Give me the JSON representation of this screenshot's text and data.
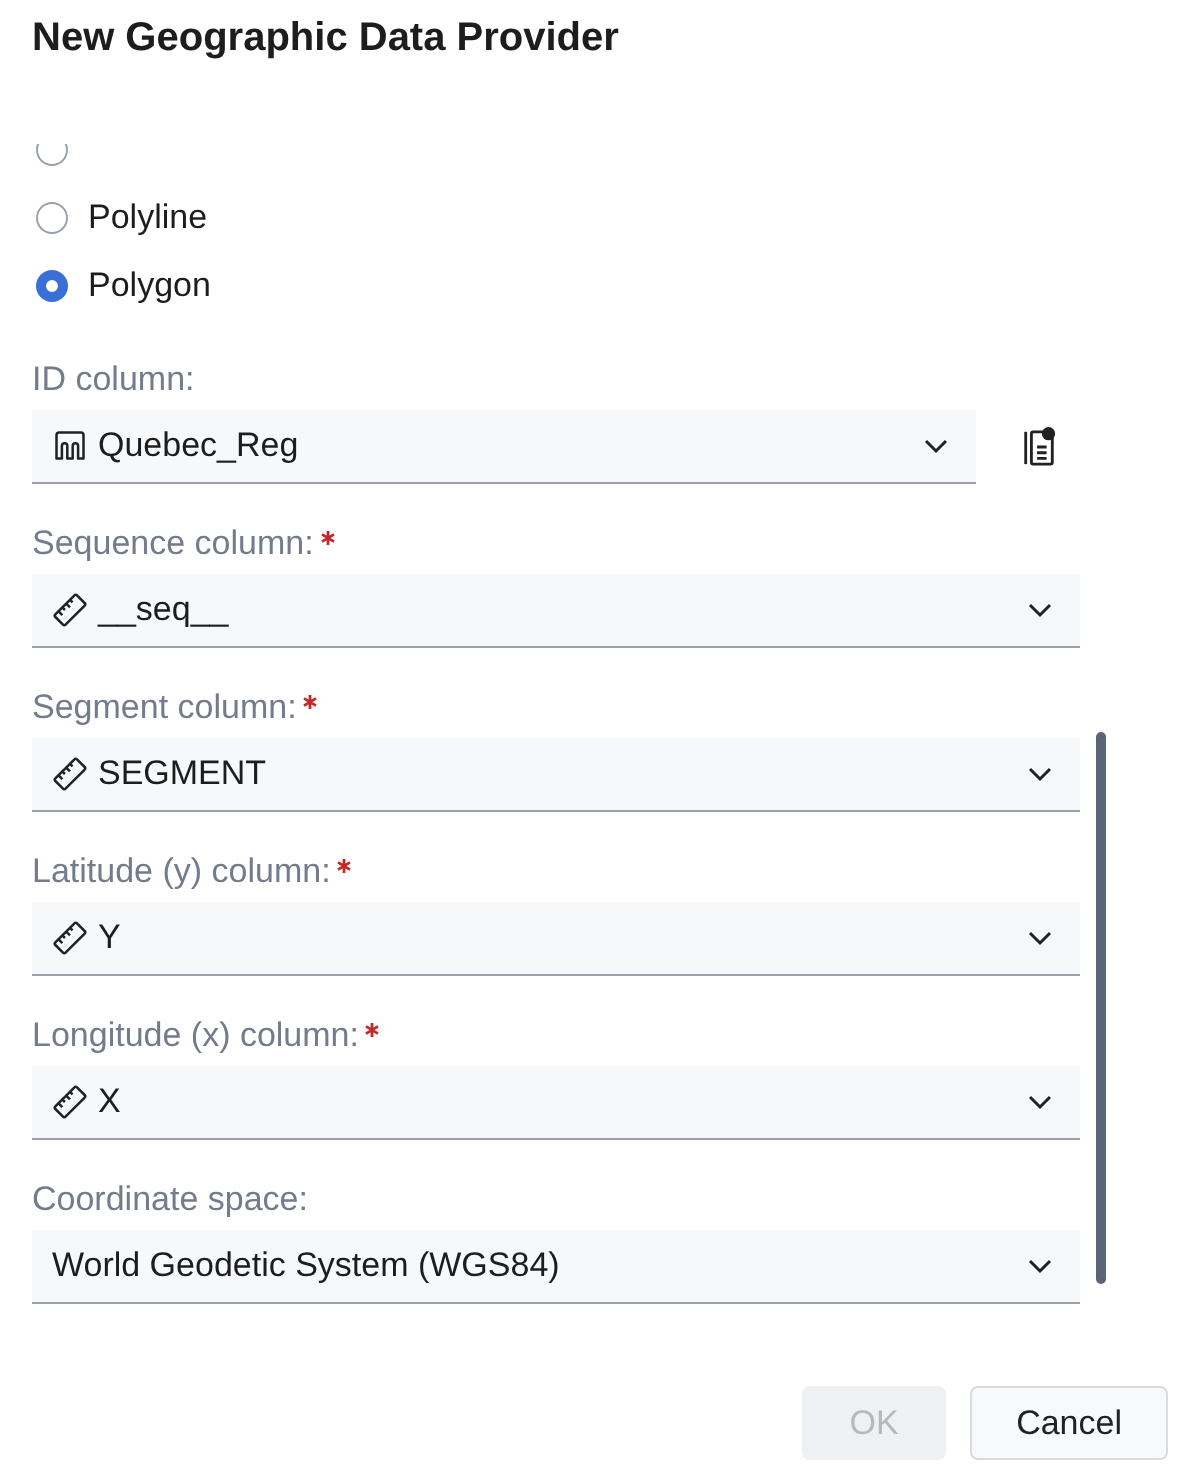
{
  "dialog": {
    "title": "New Geographic Data Provider"
  },
  "geometry_options": [
    {
      "selected": false
    },
    {
      "label": "Polyline",
      "selected": false
    },
    {
      "label": "Polygon",
      "selected": true
    }
  ],
  "fields": [
    {
      "label": "ID column:",
      "required": false,
      "kind": "shape",
      "value": "Quebec_Reg",
      "side_button": true
    },
    {
      "label": "Sequence column:",
      "required": true,
      "kind": "ruler",
      "value": "__seq__",
      "side_button": false
    },
    {
      "label": "Segment column:",
      "required": true,
      "kind": "ruler",
      "value": "SEGMENT",
      "side_button": false
    },
    {
      "label": "Latitude (y) column:",
      "required": true,
      "kind": "ruler",
      "value": "Y",
      "side_button": false
    },
    {
      "label": "Longitude (x) column:",
      "required": true,
      "kind": "ruler",
      "value": "X",
      "side_button": false
    },
    {
      "label": "Coordinate space:",
      "required": false,
      "kind": "plain",
      "value": "World Geodetic System (WGS84)",
      "side_button": false
    }
  ],
  "buttons": [
    {
      "label": "OK",
      "disabled": true
    },
    {
      "label": "Cancel",
      "disabled": false
    }
  ]
}
